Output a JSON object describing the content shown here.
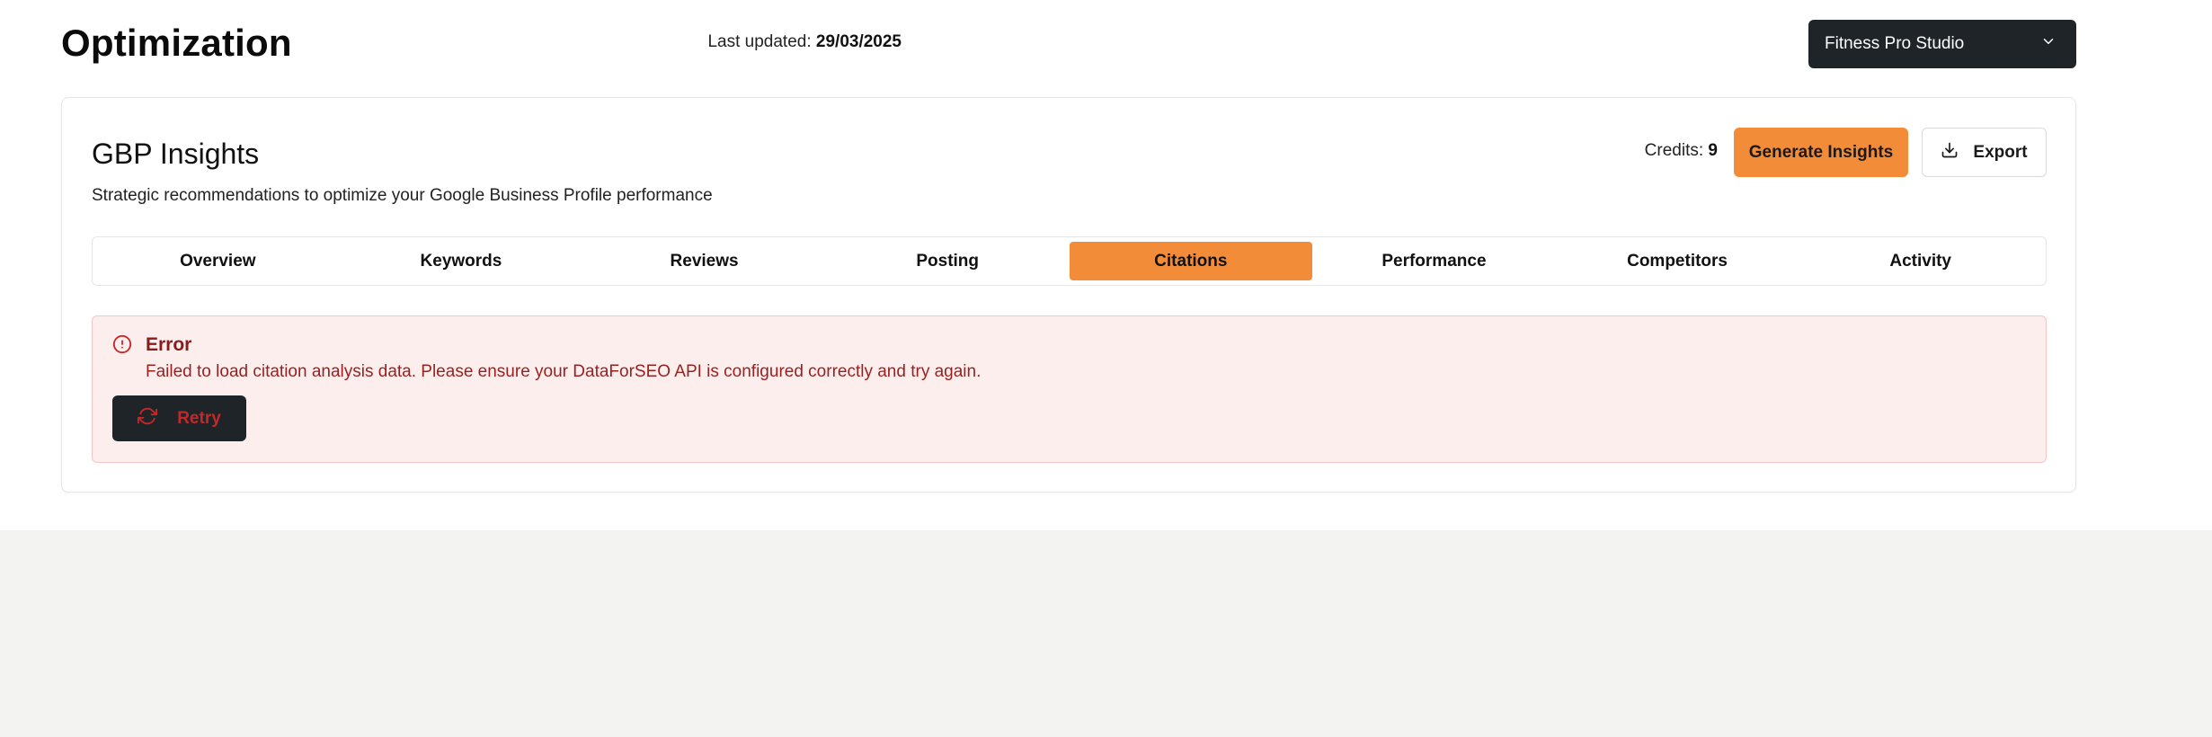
{
  "page": {
    "title": "Optimization",
    "last_updated_label": "Last updated:",
    "last_updated_value": "29/03/2025"
  },
  "business_select": {
    "selected": "Fitness Pro Studio",
    "icon": "chevron-down-icon"
  },
  "insights": {
    "title": "GBP Insights",
    "subtitle": "Strategic recommendations to optimize your Google Business Profile performance",
    "credits_label": "Credits:",
    "credits_value": "9",
    "generate_label": "Generate Insights",
    "export_label": "Export",
    "export_icon": "download-icon"
  },
  "tabs": [
    {
      "label": "Overview",
      "active": false
    },
    {
      "label": "Keywords",
      "active": false
    },
    {
      "label": "Reviews",
      "active": false
    },
    {
      "label": "Posting",
      "active": false
    },
    {
      "label": "Citations",
      "active": true
    },
    {
      "label": "Performance",
      "active": false
    },
    {
      "label": "Competitors",
      "active": false
    },
    {
      "label": "Activity",
      "active": false
    }
  ],
  "error": {
    "icon": "alert-circle-icon",
    "title": "Error",
    "message": "Failed to load citation analysis data. Please ensure your DataForSEO API is configured correctly and try again.",
    "retry_label": "Retry",
    "retry_icon": "refresh-icon"
  },
  "colors": {
    "accent": "#f28c38",
    "dark": "#1f2428",
    "error_bg": "#fdeeee",
    "error_text": "#9a1f1f"
  }
}
